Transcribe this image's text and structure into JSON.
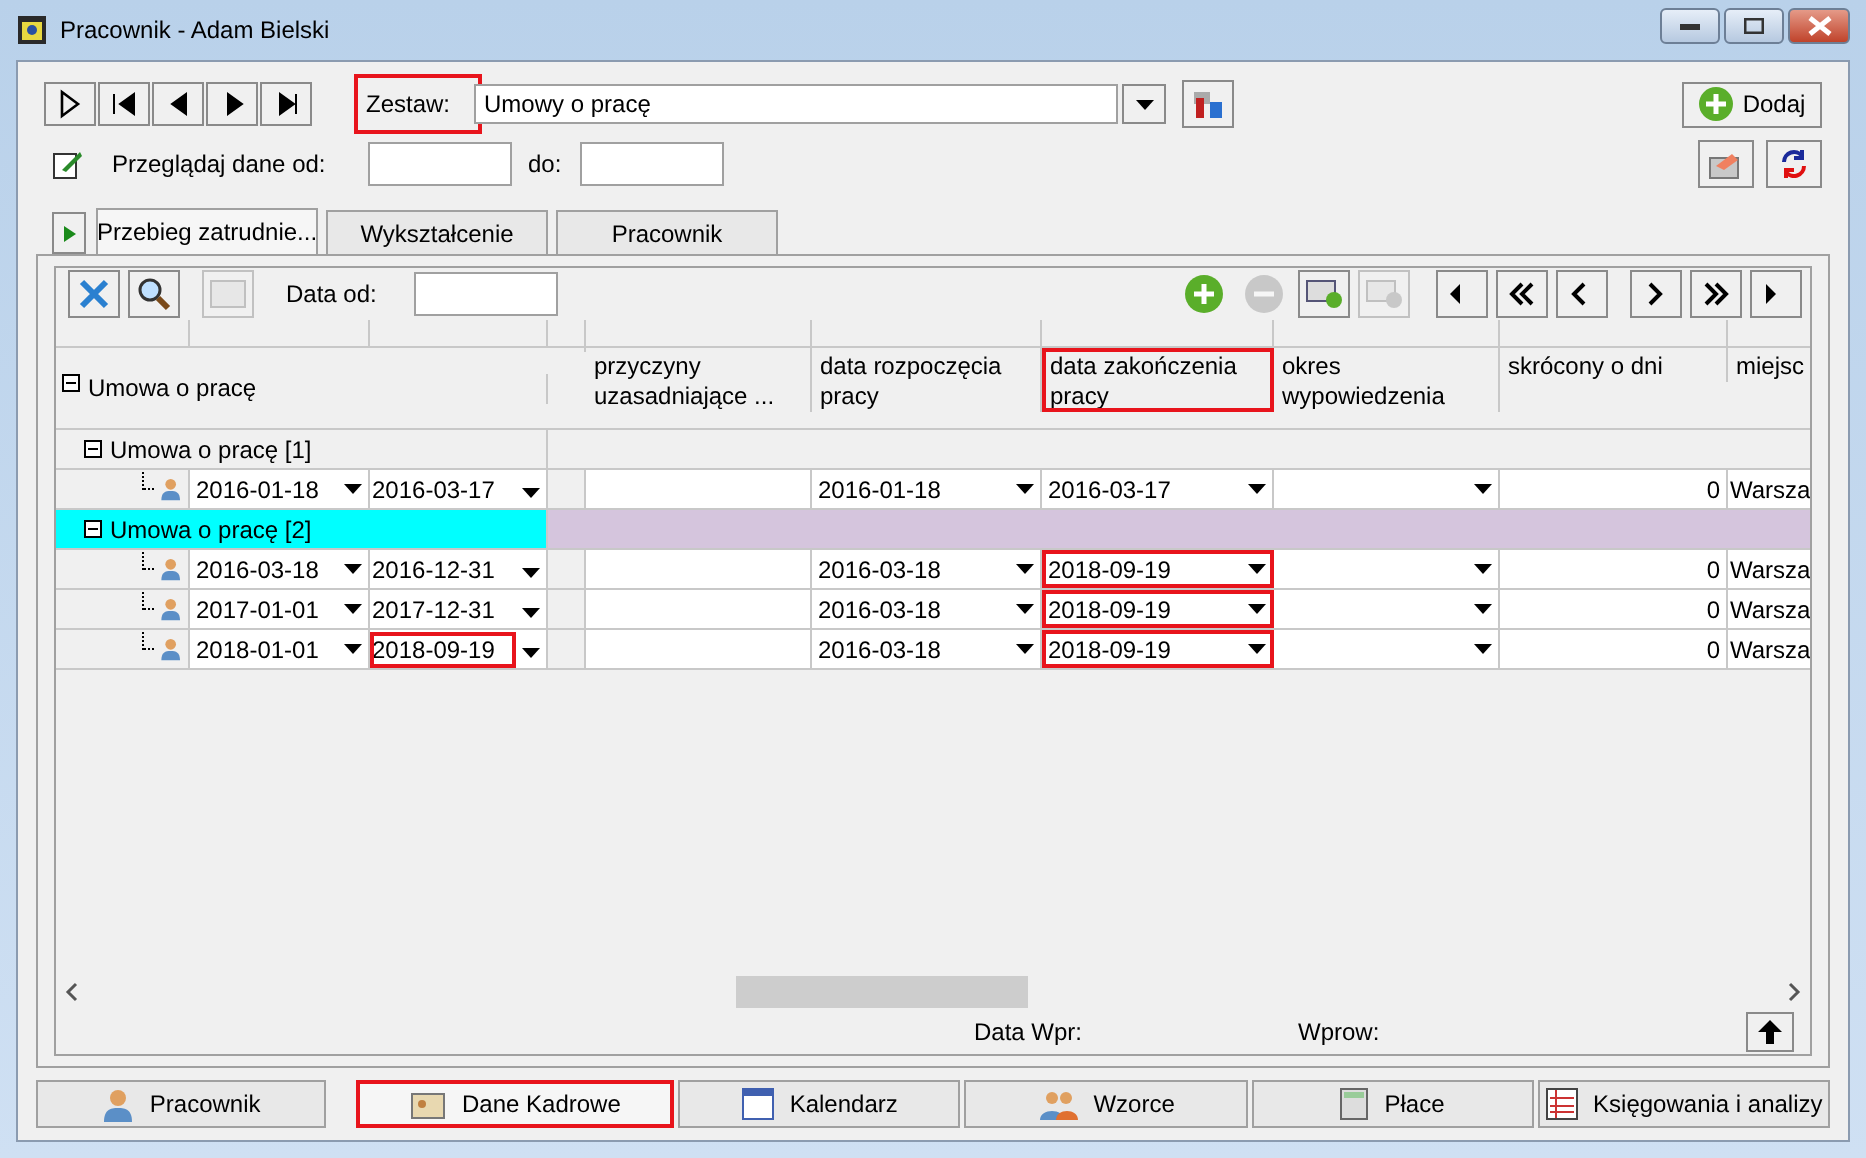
{
  "window": {
    "title": "Pracownik - Adam Bielski"
  },
  "zestaw": {
    "label": "Zestaw:",
    "value": "Umowy o pracę",
    "highlighted": true
  },
  "add_button": {
    "label": "Dodaj"
  },
  "browse": {
    "label": "Przeglądaj dane od:",
    "to_label": "do:"
  },
  "tabs": [
    {
      "label": "Przebieg zatrudnie...",
      "selected": true
    },
    {
      "label": "Wykształcenie",
      "selected": false
    },
    {
      "label": "Pracownik",
      "selected": false
    }
  ],
  "grid_toolbar": {
    "date_label": "Data od:"
  },
  "tree_header": {
    "label": "Umowa o pracę",
    "expanded": true
  },
  "columns": [
    {
      "label": "przyczyny uzasadniające ...",
      "kind": "text",
      "highlighted": false
    },
    {
      "label": "data rozpoczęcia pracy",
      "kind": "dropdown",
      "highlighted": false
    },
    {
      "label": "data zakończenia pracy",
      "kind": "dropdown",
      "highlighted": true
    },
    {
      "label": "okres wypowiedzenia",
      "kind": "dropdown",
      "highlighted": false
    },
    {
      "label": "skrócony o dni",
      "kind": "number",
      "highlighted": false
    },
    {
      "label": "miejsc",
      "kind": "text",
      "highlighted": false
    }
  ],
  "groups": [
    {
      "label": "Umowa o pracę [1]",
      "expanded": true,
      "selected": false,
      "records": [
        {
          "date_from": "2016-01-18",
          "date_to": "2016-03-17",
          "to_highlighted": false,
          "end_highlighted": false,
          "cells": [
            "",
            "2016-01-18",
            "2016-03-17",
            "",
            "0",
            "Warsza"
          ]
        }
      ]
    },
    {
      "label": "Umowa o pracę [2]",
      "expanded": true,
      "selected": true,
      "records": [
        {
          "date_from": "2016-03-18",
          "date_to": "2016-12-31",
          "to_highlighted": false,
          "end_highlighted": true,
          "cells": [
            "",
            "2016-03-18",
            "2018-09-19",
            "",
            "0",
            "Warsza"
          ]
        },
        {
          "date_from": "2017-01-01",
          "date_to": "2017-12-31",
          "to_highlighted": false,
          "end_highlighted": true,
          "cells": [
            "",
            "2016-03-18",
            "2018-09-19",
            "",
            "0",
            "Warsza"
          ]
        },
        {
          "date_from": "2018-01-01",
          "date_to": "2018-09-19",
          "to_highlighted": true,
          "end_highlighted": true,
          "cells": [
            "",
            "2016-03-18",
            "2018-09-19",
            "",
            "0",
            "Warsza"
          ]
        }
      ]
    }
  ],
  "footer": {
    "date_label": "Data Wpr:",
    "by_label": "Wprow:"
  },
  "bottom_tabs": [
    {
      "label": "Pracownik",
      "selected": false
    },
    {
      "label": "Dane Kadrowe",
      "selected": true
    },
    {
      "label": "Kalendarz",
      "selected": false
    },
    {
      "label": "Wzorce",
      "selected": false
    },
    {
      "label": "Płace",
      "selected": false
    },
    {
      "label": "Księgowania i analizy",
      "selected": false
    }
  ]
}
